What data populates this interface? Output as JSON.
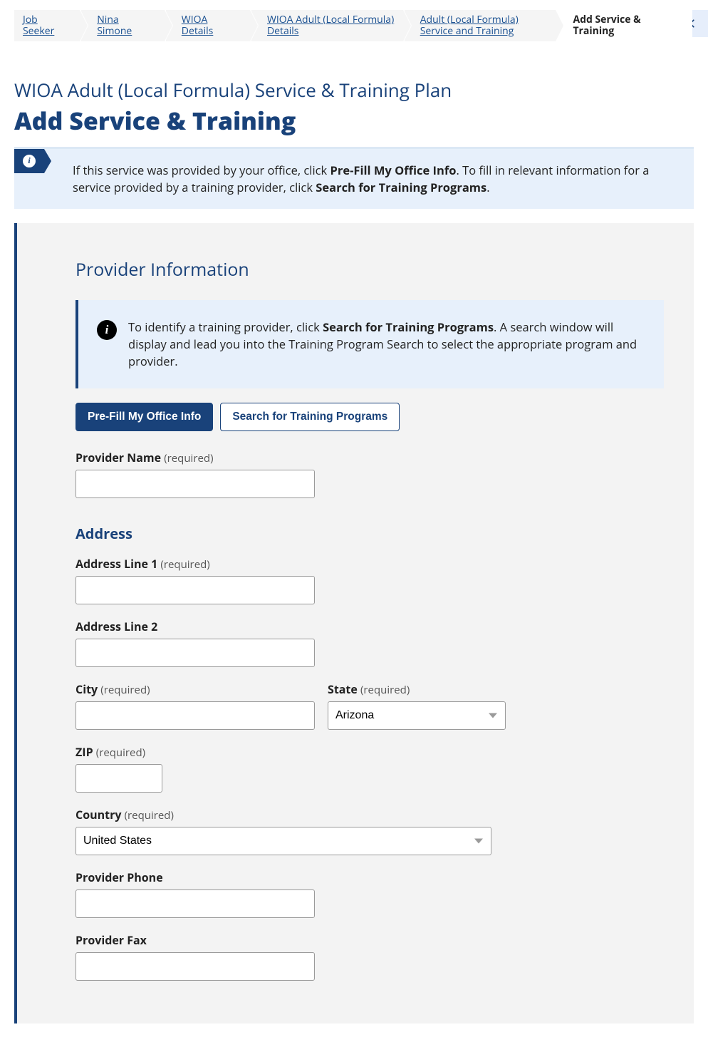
{
  "breadcrumb": [
    {
      "label": "Job Seeker"
    },
    {
      "label": "Nina Simone"
    },
    {
      "label": "WIOA Details"
    },
    {
      "label": "WIOA Adult (Local Formula) Details"
    },
    {
      "label": "Adult (Local Formula) Service and Training"
    },
    {
      "label": "Add Service & Training"
    }
  ],
  "page": {
    "supertitle": "WIOA Adult (Local Formula) Service & Training Plan",
    "title": "Add Service & Training"
  },
  "banner": {
    "t1": "If this service was provided by your office, click ",
    "b1": "Pre-Fill My Office Info",
    "t2": ". To fill in relevant information for a service provided by a training provider, click ",
    "b2": "Search for Training Programs",
    "t3": "."
  },
  "section": {
    "provider_h": "Provider Information",
    "address_h": "Address"
  },
  "callout": {
    "t1": "To identify a training provider, click ",
    "b1": "Search for Training Programs",
    "t2": ". A search window will display and lead you into the Training Program Search to select the appropriate program and provider."
  },
  "buttons": {
    "prefill": "Pre-Fill My Office Info",
    "search": "Search for Training Programs"
  },
  "labels": {
    "provider_name": "Provider Name",
    "addr1": "Address Line 1",
    "addr2": "Address Line 2",
    "city": "City",
    "state": "State",
    "zip": "ZIP",
    "country": "Country",
    "phone": "Provider Phone",
    "fax": "Provider Fax",
    "required": "(required)"
  },
  "values": {
    "state": "Arizona",
    "country": "United States"
  }
}
